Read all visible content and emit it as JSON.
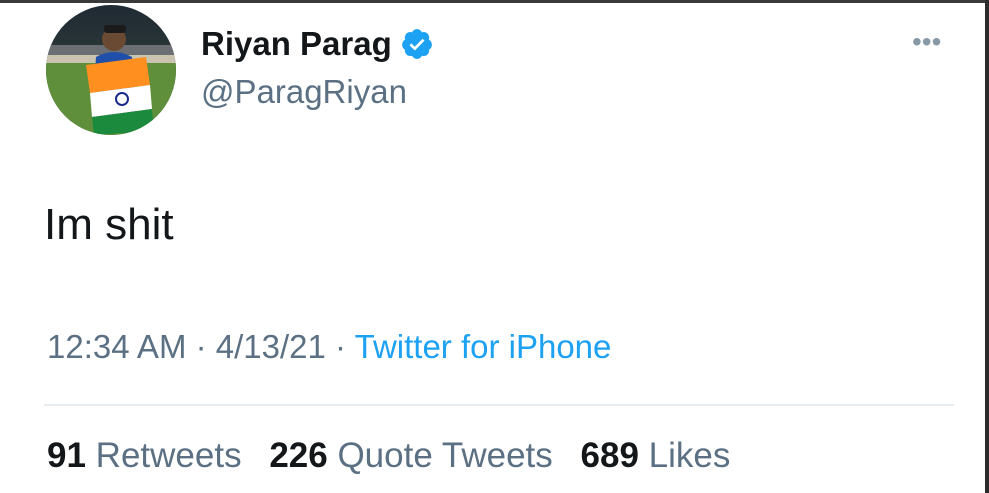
{
  "author": {
    "display_name": "Riyan Parag",
    "handle": "@ParagRiyan",
    "verified": true,
    "avatar_icon": "profile-photo",
    "verified_icon": "verified-badge-icon"
  },
  "more_menu": {
    "icon": "more-dots-icon",
    "glyph": "•••"
  },
  "tweet": {
    "text": "Im shit"
  },
  "meta": {
    "time": "12:34 AM",
    "separator_1": " · ",
    "date": "4/13/21",
    "separator_2": " · ",
    "source": "Twitter for iPhone"
  },
  "stats": {
    "retweets": {
      "count": "91",
      "label": "Retweets"
    },
    "quote_tweets": {
      "count": "226",
      "label": "Quote Tweets"
    },
    "likes": {
      "count": "689",
      "label": "Likes"
    }
  },
  "colors": {
    "accent": "#1da1f2",
    "muted": "#5b7083",
    "text": "#14171a",
    "divider": "#e6ecf0"
  }
}
